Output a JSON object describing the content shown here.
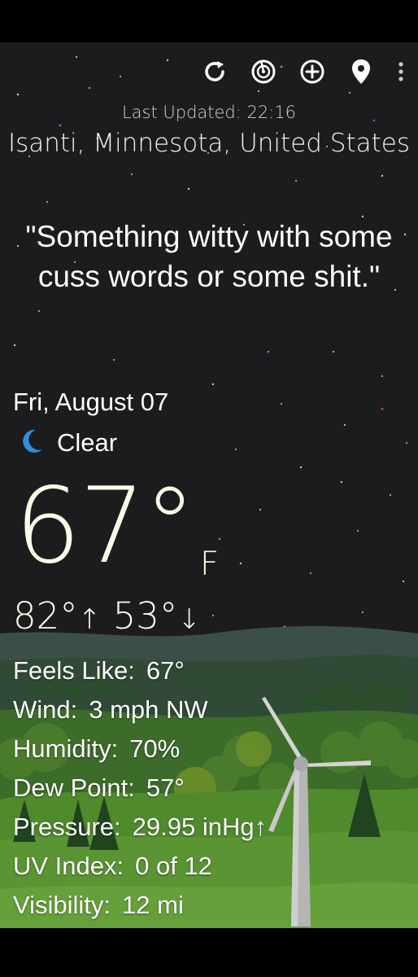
{
  "toolbar": {
    "icons": [
      "refresh-icon",
      "radar-icon",
      "add-location-icon",
      "location-pin-icon",
      "overflow-menu-icon"
    ]
  },
  "last_updated": "Last Updated: 22:16",
  "location": "Isanti, Minnesota, United States",
  "quote": "\"Something witty with some cuss words or some shit.\"",
  "date": "Fri, August 07",
  "condition": {
    "icon": "crescent-moon-icon",
    "label": "Clear"
  },
  "temperature": {
    "current": "67°",
    "unit": "F",
    "high": "82°",
    "high_arrow": "↑",
    "low": "53°",
    "low_arrow": "↓"
  },
  "details": [
    {
      "label": "Feels Like:",
      "value": "67°"
    },
    {
      "label": "Wind:",
      "value": "3 mph NW"
    },
    {
      "label": "Humidity:",
      "value": "70%"
    },
    {
      "label": "Dew Point:",
      "value": "57°"
    },
    {
      "label": "Pressure:",
      "value": "29.95 inHg↑"
    },
    {
      "label": "UV Index:",
      "value": "0 of 12"
    },
    {
      "label": "Visibility:",
      "value": "12 mi"
    }
  ],
  "colors": {
    "background": "#1c1c1e",
    "text": "#ffffff",
    "temperature": "#fbfbe9",
    "moon": "#2f8fe0",
    "grass": "#4f8a2c"
  }
}
